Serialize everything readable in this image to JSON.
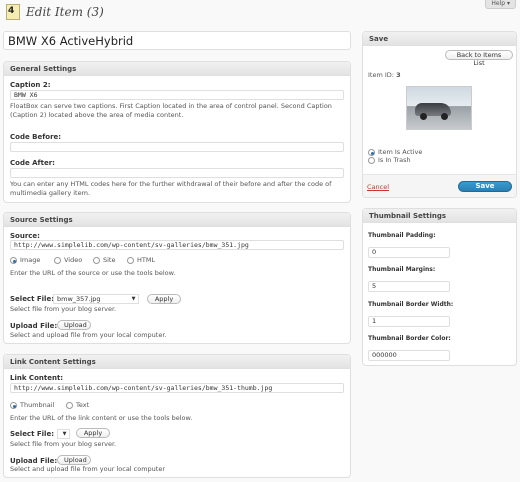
{
  "header": {
    "title": "Edit Item (3)",
    "help_label": "Help ▾"
  },
  "item_title": "BMW X6 ActiveHybrid",
  "general": {
    "heading": "General Settings",
    "caption2_label": "Caption 2:",
    "caption2_value": "BMW X6",
    "caption2_help": "FloatBox can serve two captions. First Caption located in the area of control panel. Second Caption (Caption 2) located above the area of media content.",
    "code_before_label": "Code Before:",
    "code_before_value": "",
    "code_after_label": "Code After:",
    "code_after_value": "",
    "code_help": "You can enter any HTML codes here for the further withdrawal of their before and after the code of multimedia gallery item."
  },
  "source": {
    "heading": "Source Settings",
    "source_label": "Source:",
    "source_value": "http://www.simplelib.com/wp-content/sv-galleries/bmw_351.jpg",
    "radios": [
      {
        "label": "Image",
        "checked": true
      },
      {
        "label": "Video",
        "checked": false
      },
      {
        "label": "Site",
        "checked": false
      },
      {
        "label": "HTML",
        "checked": false
      }
    ],
    "source_help": "Enter the URL of the source or use the tools below.",
    "select_file_label": "Select File:",
    "select_file_value": "bmw_357.jpg",
    "apply_label": "Apply",
    "select_help": "Select file from your blog server.",
    "upload_label": "Upload File:",
    "upload_button": "Upload",
    "upload_help": "Select and upload file from your local computer."
  },
  "link": {
    "heading": "Link Content Settings",
    "link_label": "Link Content:",
    "link_value": "http://www.simplelib.com/wp-content/sv-galleries/bmw_351-thumb.jpg",
    "radios": [
      {
        "label": "Thumbnail",
        "checked": true
      },
      {
        "label": "Text",
        "checked": false
      }
    ],
    "link_help": "Enter the URL of the link content or use the tools below.",
    "select_file_label": "Select File:",
    "select_file_value": "",
    "apply_label": "Apply",
    "select_help": "Select file from your blog server.",
    "upload_label": "Upload File:",
    "upload_button": "Upload",
    "upload_help": "Select and upload file from your local computer"
  },
  "save": {
    "heading": "Save",
    "back_button": "Back to Items List",
    "item_id_label": "Item ID:",
    "item_id_value": "3",
    "status": [
      {
        "label": "Item Is Active",
        "checked": true
      },
      {
        "label": "Is In Trash",
        "checked": false
      }
    ],
    "cancel_label": "Cancel",
    "save_label": "Save"
  },
  "thumbnail": {
    "heading": "Thumbnail Settings",
    "padding_label": "Thumbnail Padding:",
    "padding_value": "0",
    "margins_label": "Thumbnail Margins:",
    "margins_value": "5",
    "border_width_label": "Thumbnail Border Width:",
    "border_width_value": "1",
    "border_color_label": "Thumbnail Border Color:",
    "border_color_value": "000000"
  },
  "colors": {
    "accent": "#2a7fb2",
    "cancel": "#cc3333",
    "box_header": "#e3e3e3"
  }
}
